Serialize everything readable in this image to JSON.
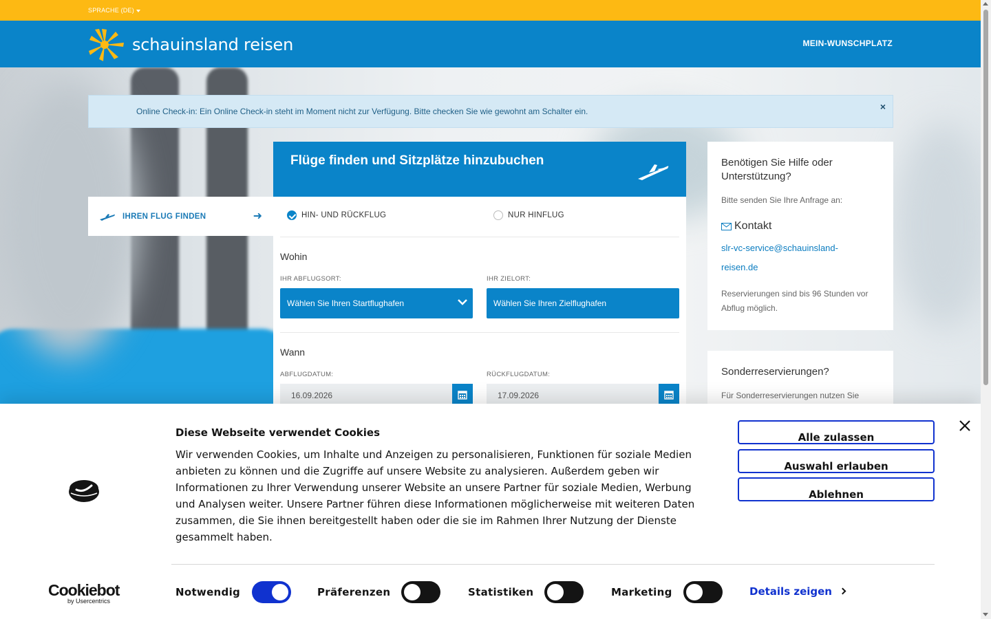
{
  "topbar": {
    "language_label": "SPRACHE (DE)"
  },
  "header": {
    "logo_text": "schauinsland reisen",
    "nav_wunschplatz": "MEIN-WUNSCHPLATZ"
  },
  "alert": {
    "text": "Online Check-in: Ein Online Check-in steht im Moment nicht zur Verfügung. Bitte checken Sie wie gewohnt am Schalter ein.",
    "close": "×"
  },
  "sidetab": {
    "label": "IHREN FLUG FINDEN",
    "arrow": "➜"
  },
  "search": {
    "title": "Flüge finden und Sitzplätze hinzubuchen",
    "trip_types": [
      {
        "label": "HIN- UND RÜCKFLUG",
        "checked": true
      },
      {
        "label": "NUR HINFLUG",
        "checked": false
      }
    ],
    "where": {
      "title": "Wohin",
      "origin_label": "IHR ABFLUGSORT:",
      "origin_value": "Wählen Sie Ihren Startflughafen",
      "destination_label": "IHR ZIELORT:",
      "destination_value": "Wählen Sie Ihren Zielflughafen"
    },
    "when": {
      "title": "Wann",
      "departure_label": "ABFLUGDATUM:",
      "departure_value": "16.09.2026",
      "return_label": "RÜCKFLUGDATUM:",
      "return_value": "17.09.2026"
    }
  },
  "help": {
    "title": "Benötigen Sie Hilfe oder Unterstützung?",
    "subtitle": "Bitte senden Sie Ihre Anfrage an:",
    "contact_label": "Kontakt",
    "email": "slr-vc-service@schauinsland-reisen.de",
    "note": "Reservierungen sind bis 96 Stunden vor Abflug möglich."
  },
  "special": {
    "title": "Sonderreservierungen?",
    "text": "Für Sonderreservierungen nutzen Sie"
  },
  "cookie": {
    "title": "Diese Webseite verwendet Cookies",
    "text": "Wir verwenden Cookies, um Inhalte und Anzeigen zu personalisieren, Funktionen für soziale Medien anbieten zu können und die Zugriffe auf unsere Website zu analysieren. Außerdem geben wir Informationen zu Ihrer Verwendung unserer Website an unsere Partner für soziale Medien, Werbung und Analysen weiter. Unsere Partner führen diese Informationen möglicherweise mit weiteren Daten zusammen, die Sie ihnen bereitgestellt haben oder die sie im Rahmen Ihrer Nutzung der Dienste gesammelt haben.",
    "buttons": {
      "allow_all": "Alle zulassen",
      "allow_selection": "Auswahl erlauben",
      "deny": "Ablehnen"
    },
    "toggles": [
      {
        "label": "Notwendig",
        "on": true
      },
      {
        "label": "Präferenzen",
        "on": false
      },
      {
        "label": "Statistiken",
        "on": false
      },
      {
        "label": "Marketing",
        "on": false
      }
    ],
    "details_label": "Details zeigen",
    "brand": "Cookiebot",
    "brand_sub": "by Usercentrics"
  },
  "colors": {
    "brand_blue": "#0a84c9",
    "brand_yellow": "#fdb913",
    "cookie_blue": "#1032cf"
  },
  "icons": [
    "sun-logo-icon",
    "caret-down-icon",
    "plane-icon",
    "arrow-right-icon",
    "check-icon",
    "chevron-down-icon",
    "calendar-icon",
    "envelope-icon",
    "close-icon",
    "cookie-logo-icon"
  ]
}
